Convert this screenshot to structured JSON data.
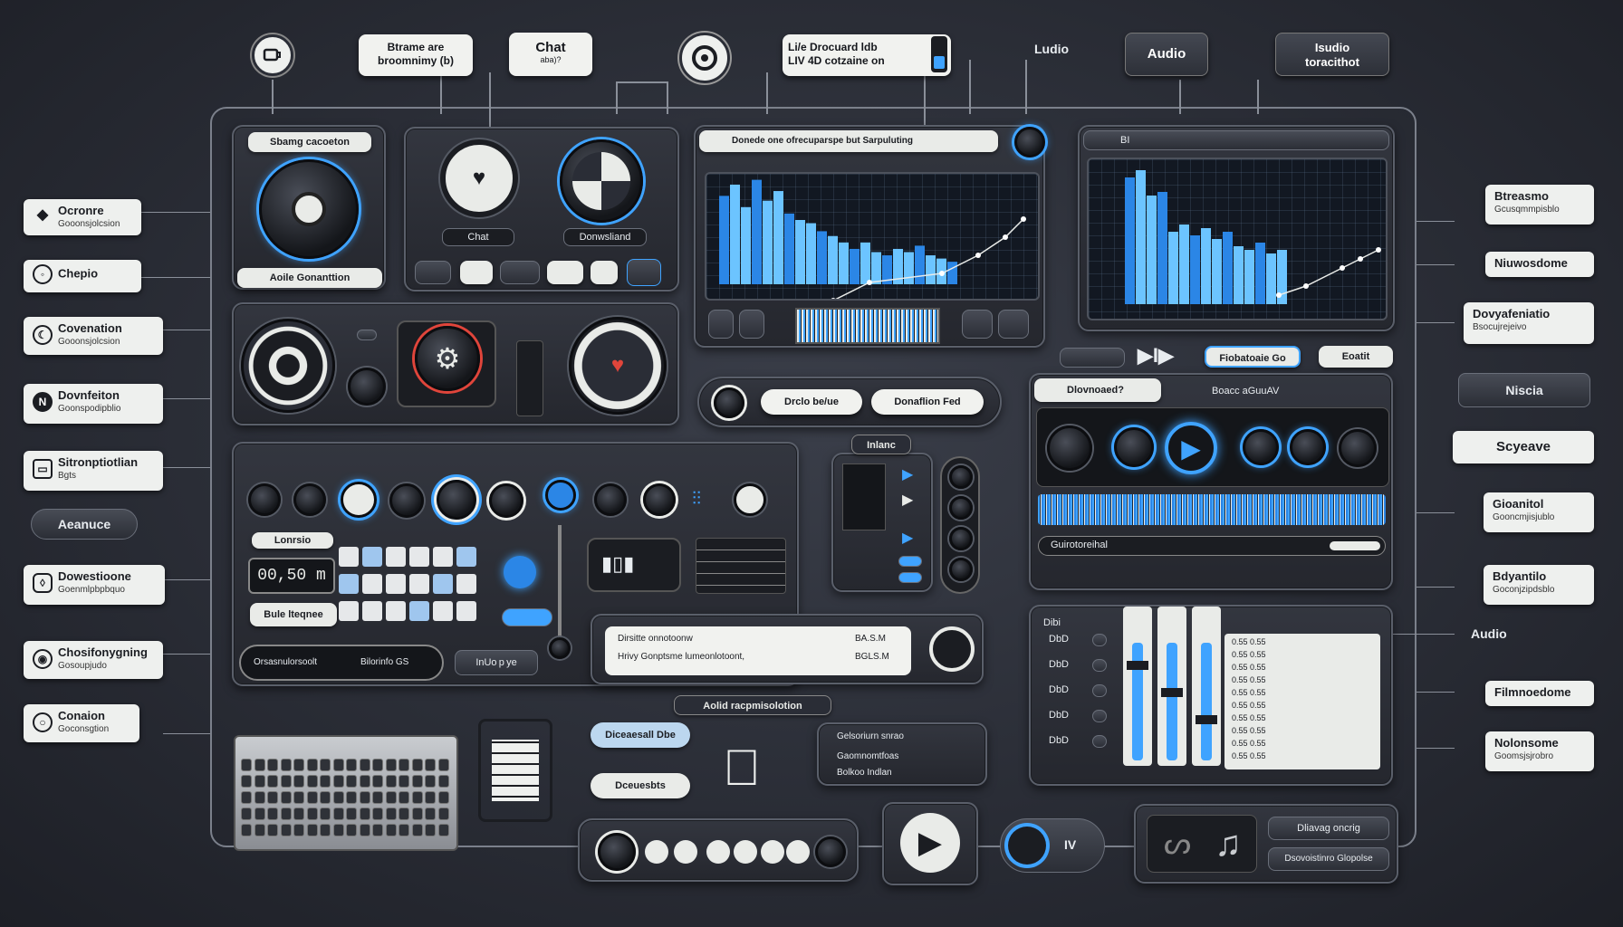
{
  "colors": {
    "accent": "#3fa3ff",
    "background": "#2a2d36",
    "heart": "#e0453b",
    "label_bg": "#eef0ee"
  },
  "top": {
    "bubble_streams": "Btrame are\nbroomnimy (b)",
    "bubble_chat": "Chat",
    "bubble_chat_sub": "aba)?",
    "bubble_live": "Li/e Drocuard ldb\nLIV 4D cotzaine on",
    "label_audio_plain": "Ludio",
    "bubble_audio": "Audio",
    "bubble_studio": "Isudio\ntoracithot"
  },
  "left_labels": [
    {
      "title": "Ocronre",
      "sub": "Gooonsjolcsion",
      "icon": "diamond-icon"
    },
    {
      "title": "Chepio",
      "sub": "",
      "icon": "circle-icon"
    },
    {
      "title": "Covenation",
      "sub": "Gooonsjolcsion",
      "icon": "moon-icon"
    },
    {
      "title": "Dovnfeiton",
      "sub": "Goonspodipblio",
      "icon": "n-icon"
    },
    {
      "title": "Sitronptiotlian",
      "sub": "Bgts",
      "icon": "window-icon"
    },
    {
      "title": "Aeanuce",
      "sub": "",
      "icon": ""
    },
    {
      "title": "Dowestioone",
      "sub": "Goenmlpbpbquo",
      "icon": "shield-icon"
    },
    {
      "title": "Chosifonygning",
      "sub": "Gosoupjudo",
      "icon": "target-icon"
    },
    {
      "title": "Conaion",
      "sub": "Goconsgtion",
      "icon": "ring-icon"
    }
  ],
  "right_labels": [
    {
      "title": "Btreasmo",
      "sub": "Gcusqmmpisblo"
    },
    {
      "title": "Niuwosdome",
      "sub": ""
    },
    {
      "title": "Dovyafeniatio",
      "sub": "Bsocujrejeivo"
    },
    {
      "title": "Niscia",
      "sub": ""
    },
    {
      "title": "Scyeave",
      "sub": ""
    },
    {
      "title": "Gioanitol",
      "sub": "Gooncmjisjublo"
    },
    {
      "title": "Bdyantilo",
      "sub": "Goconjzipdsblo"
    },
    {
      "title": "Audio",
      "sub": ""
    },
    {
      "title": "Filmnoedome",
      "sub": ""
    },
    {
      "title": "Nolonsome",
      "sub": "Goomsjsjrobro"
    }
  ],
  "panel_streaming": {
    "header": "Sbamg cacoeton",
    "footer": "Aoile Gonanttion"
  },
  "panel_chat": {
    "chat_label": "Chat",
    "download_label": "Donwsliand"
  },
  "panel_graph1": {
    "address": "Donede one ofrecuparspe but Sarpuluting",
    "top_btn": ""
  },
  "graph1_data": [
    55,
    62,
    48,
    65,
    52,
    58,
    44,
    40,
    38,
    33,
    30,
    26,
    22,
    26,
    20,
    18,
    22,
    20,
    24,
    18,
    16,
    14
  ],
  "graph2_data": [
    70,
    74,
    60,
    62,
    40,
    44,
    38,
    42,
    36,
    40,
    32,
    30,
    34,
    28,
    30
  ],
  "panel_graph2": {
    "header": "BI"
  },
  "mid_controls": {
    "btn1": "",
    "btn2": "Fiobatoaie Go",
    "btn3": "Eoatit"
  },
  "pills": {
    "left": "Drclo be/ue",
    "right": "Donaflion Fed"
  },
  "media_player": {
    "header": "Dlovnoaed?",
    "title": "Boacc aGuuAV",
    "bottom_bar": "Guirotoreihal"
  },
  "mixer_panel": {
    "time": "00,50 m",
    "label_top": "Lonrsio",
    "label_bottom": "Bule lteqnee",
    "blue_btn": ""
  },
  "screen_small": {
    "title": "Inlanc"
  },
  "notes_panel": {
    "row1": "Dirsitte onnotoonw",
    "row1_val": "BA.S.M",
    "row2": "Hrivy Gonptsme lumeonlotoont,",
    "row2_val": "BGLS.M"
  },
  "waveform_bar": {
    "left": "Orsasnulorsoolt",
    "right": "Bilorinfo GS",
    "pill": "InUo p ye"
  },
  "caption": "Aolid racpmisolotion",
  "mixer_table": {
    "header": "Dibi",
    "rows": [
      "DbD",
      "DbD",
      "DbD",
      "DbD",
      "DbD"
    ],
    "cells": [
      "0.55 0.55",
      "0.55 0.55",
      "0.55 0.55",
      "0.55 0.55",
      "0.55 0.55",
      "0.55 0.55",
      "0.55 0.55",
      "0.55 0.55",
      "0.55 0.55",
      "0.55 0.55"
    ]
  },
  "bottom": {
    "chip1": "Diceaesall Dbe",
    "chip2": "Dceuesbts",
    "menu1": "Gelsoriurn snrao",
    "menu2": "Gaomnomtfoas",
    "menu3": "Bolkoo Indlan",
    "toggle": "IV",
    "music_label1": "Dliavag oncrig",
    "music_label2": "Dsovoistinro Glopolse"
  }
}
